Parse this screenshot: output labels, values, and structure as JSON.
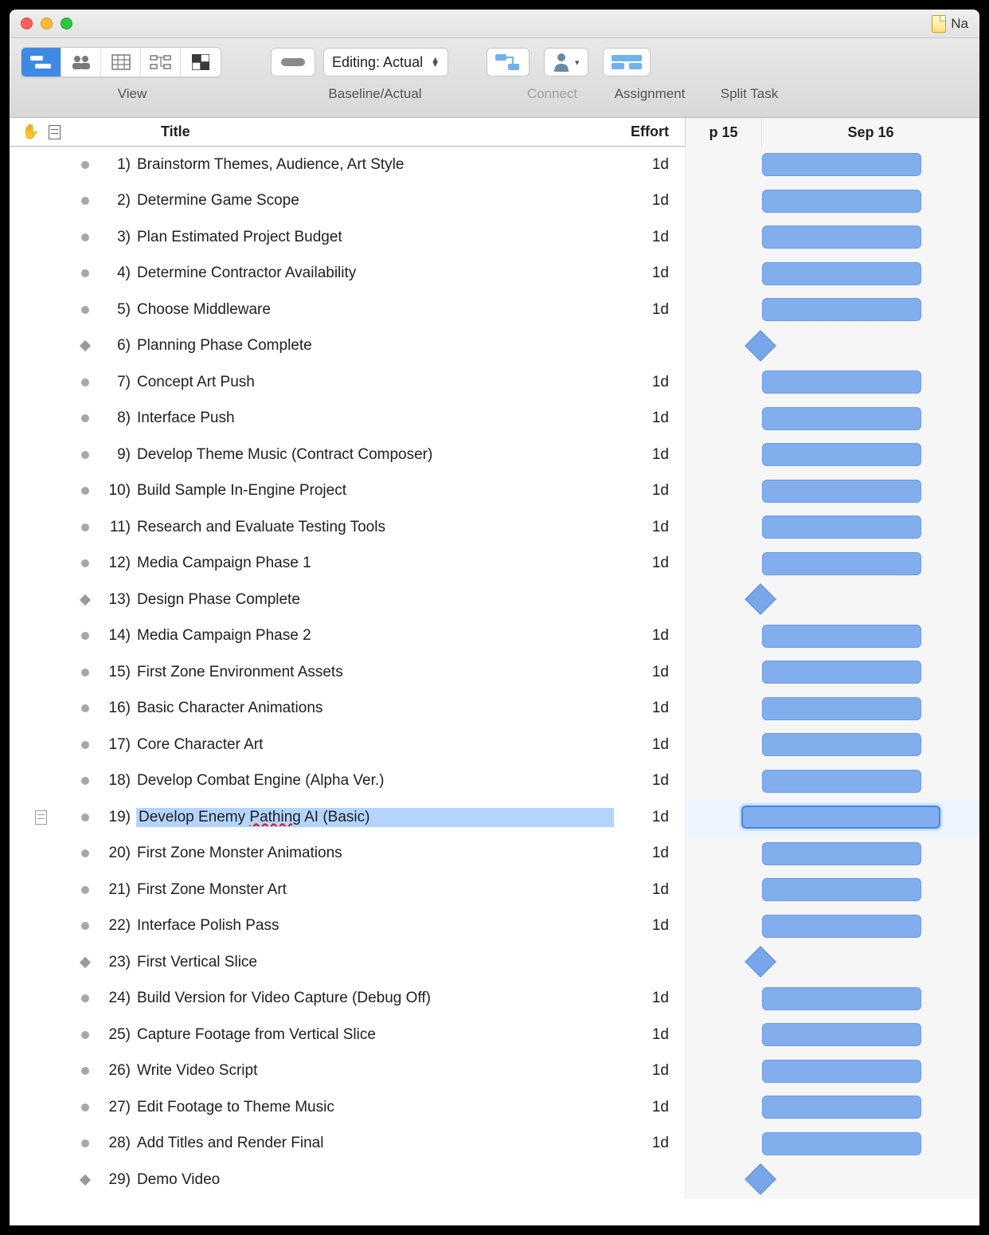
{
  "window": {
    "doc_name": "Na"
  },
  "toolbar": {
    "view_label": "View",
    "baseline_label": "Baseline/Actual",
    "editing_label": "Editing: Actual",
    "connect_label": "Connect",
    "assignment_label": "Assignment",
    "split_label": "Split Task"
  },
  "columns": {
    "title": "Title",
    "effort": "Effort"
  },
  "gantt_headers": [
    "p 15",
    "Sep 16"
  ],
  "selected_row_index": 18,
  "tasks": [
    {
      "n": "1)",
      "title": "Brainstorm Themes, Audience, Art Style",
      "effort": "1d",
      "milestone": false
    },
    {
      "n": "2)",
      "title": "Determine Game Scope",
      "effort": "1d",
      "milestone": false
    },
    {
      "n": "3)",
      "title": "Plan Estimated Project Budget",
      "effort": "1d",
      "milestone": false
    },
    {
      "n": "4)",
      "title": "Determine Contractor Availability",
      "effort": "1d",
      "milestone": false
    },
    {
      "n": "5)",
      "title": "Choose Middleware",
      "effort": "1d",
      "milestone": false
    },
    {
      "n": "6)",
      "title": "Planning Phase Complete",
      "effort": "",
      "milestone": true
    },
    {
      "n": "7)",
      "title": "Concept Art Push",
      "effort": "1d",
      "milestone": false
    },
    {
      "n": "8)",
      "title": "Interface Push",
      "effort": "1d",
      "milestone": false
    },
    {
      "n": "9)",
      "title": "Develop Theme Music (Contract Composer)",
      "effort": "1d",
      "milestone": false
    },
    {
      "n": "10)",
      "title": "Build Sample In-Engine Project",
      "effort": "1d",
      "milestone": false
    },
    {
      "n": "11)",
      "title": "Research and Evaluate Testing Tools",
      "effort": "1d",
      "milestone": false
    },
    {
      "n": "12)",
      "title": "Media Campaign Phase 1",
      "effort": "1d",
      "milestone": false
    },
    {
      "n": "13)",
      "title": "Design Phase Complete",
      "effort": "",
      "milestone": true
    },
    {
      "n": "14)",
      "title": "Media Campaign Phase 2",
      "effort": "1d",
      "milestone": false
    },
    {
      "n": "15)",
      "title": "First Zone Environment Assets",
      "effort": "1d",
      "milestone": false
    },
    {
      "n": "16)",
      "title": "Basic Character Animations",
      "effort": "1d",
      "milestone": false
    },
    {
      "n": "17)",
      "title": "Core Character Art",
      "effort": "1d",
      "milestone": false
    },
    {
      "n": "18)",
      "title": "Develop Combat Engine (Alpha Ver.)",
      "effort": "1d",
      "milestone": false
    },
    {
      "n": "19)",
      "title": "Develop Enemy Pathing AI (Basic)",
      "effort": "1d",
      "milestone": false,
      "note": true,
      "editing": true,
      "spell_words": [
        "Pathing"
      ]
    },
    {
      "n": "20)",
      "title": "First Zone Monster Animations",
      "effort": "1d",
      "milestone": false
    },
    {
      "n": "21)",
      "title": "First Zone Monster Art",
      "effort": "1d",
      "milestone": false
    },
    {
      "n": "22)",
      "title": "Interface Polish Pass",
      "effort": "1d",
      "milestone": false
    },
    {
      "n": "23)",
      "title": "First Vertical Slice",
      "effort": "",
      "milestone": true
    },
    {
      "n": "24)",
      "title": "Build Version for Video Capture (Debug Off)",
      "effort": "1d",
      "milestone": false
    },
    {
      "n": "25)",
      "title": "Capture Footage from Vertical Slice",
      "effort": "1d",
      "milestone": false
    },
    {
      "n": "26)",
      "title": "Write Video Script",
      "effort": "1d",
      "milestone": false
    },
    {
      "n": "27)",
      "title": "Edit Footage to Theme Music",
      "effort": "1d",
      "milestone": false
    },
    {
      "n": "28)",
      "title": "Add Titles and Render Final",
      "effort": "1d",
      "milestone": false
    },
    {
      "n": "29)",
      "title": "Demo Video",
      "effort": "",
      "milestone": true
    }
  ]
}
